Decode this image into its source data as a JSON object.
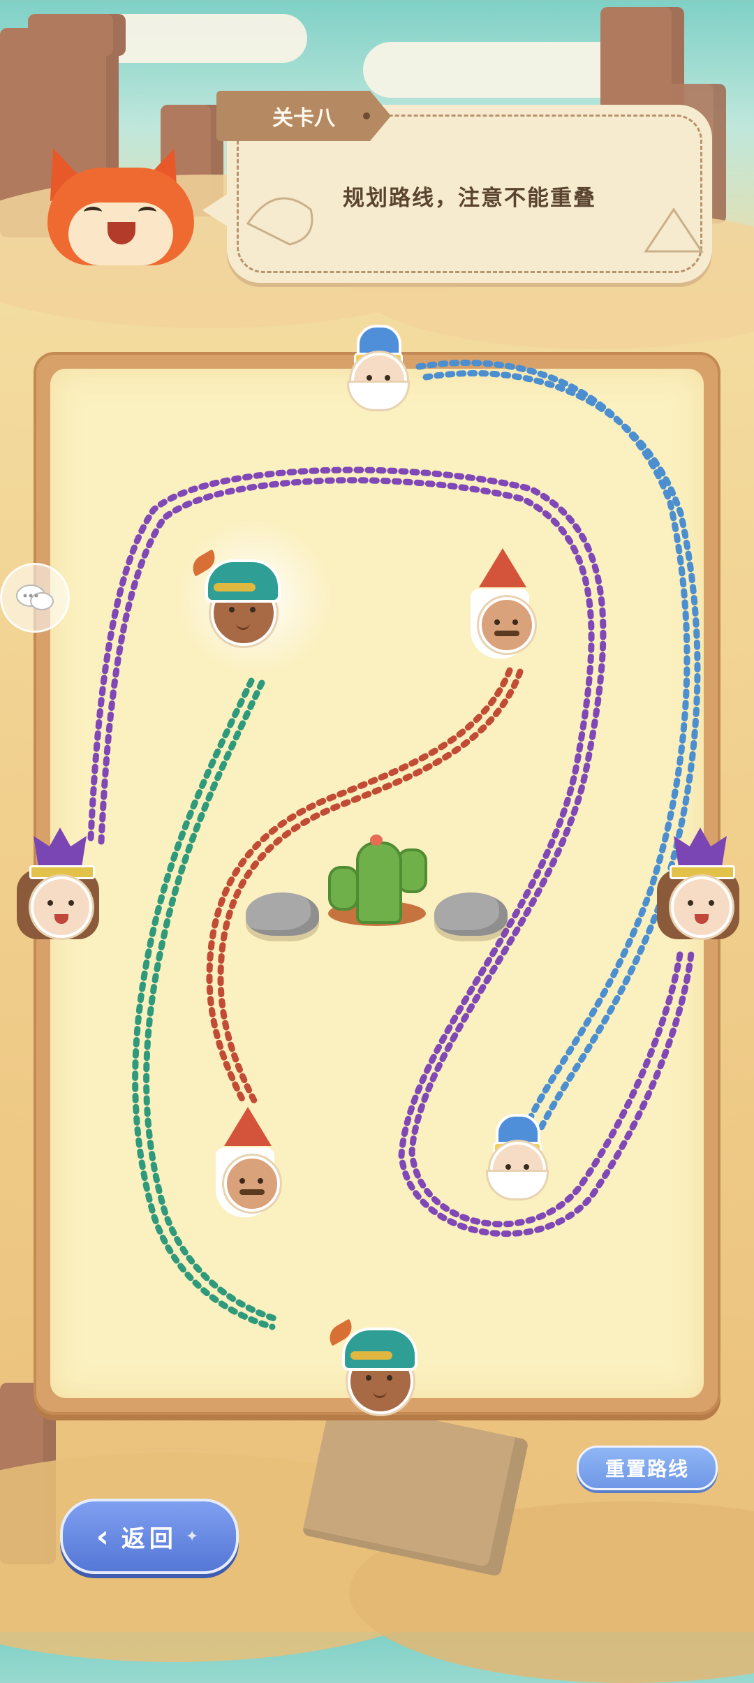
{
  "level": {
    "tag": "关卡八"
  },
  "instruction": "规划路线，注意不能重叠",
  "buttons": {
    "reset": "重置路线",
    "back": "返回"
  },
  "icons": {
    "chat": "chat-bubbles-icon",
    "back": "back-arrow-icon"
  },
  "colors": {
    "blue_path": "#4b8fd0",
    "purple_path": "#7f48b6",
    "red_path": "#c14b34",
    "green_path": "#2f9a7b"
  },
  "characters": [
    {
      "id": "old-man-top",
      "kind": "old-man"
    },
    {
      "id": "turban-upper",
      "kind": "turban-man",
      "highlight": true
    },
    {
      "id": "red-hat-upper",
      "kind": "red-hat-man"
    },
    {
      "id": "purple-girl-left",
      "kind": "purple-crown-girl"
    },
    {
      "id": "purple-girl-right",
      "kind": "purple-crown-girl"
    },
    {
      "id": "red-hat-lower",
      "kind": "red-hat-man"
    },
    {
      "id": "old-man-lower",
      "kind": "old-man"
    },
    {
      "id": "turban-bottom",
      "kind": "turban-man"
    }
  ],
  "paths_drawn": [
    "blue",
    "purple",
    "red",
    "green"
  ]
}
